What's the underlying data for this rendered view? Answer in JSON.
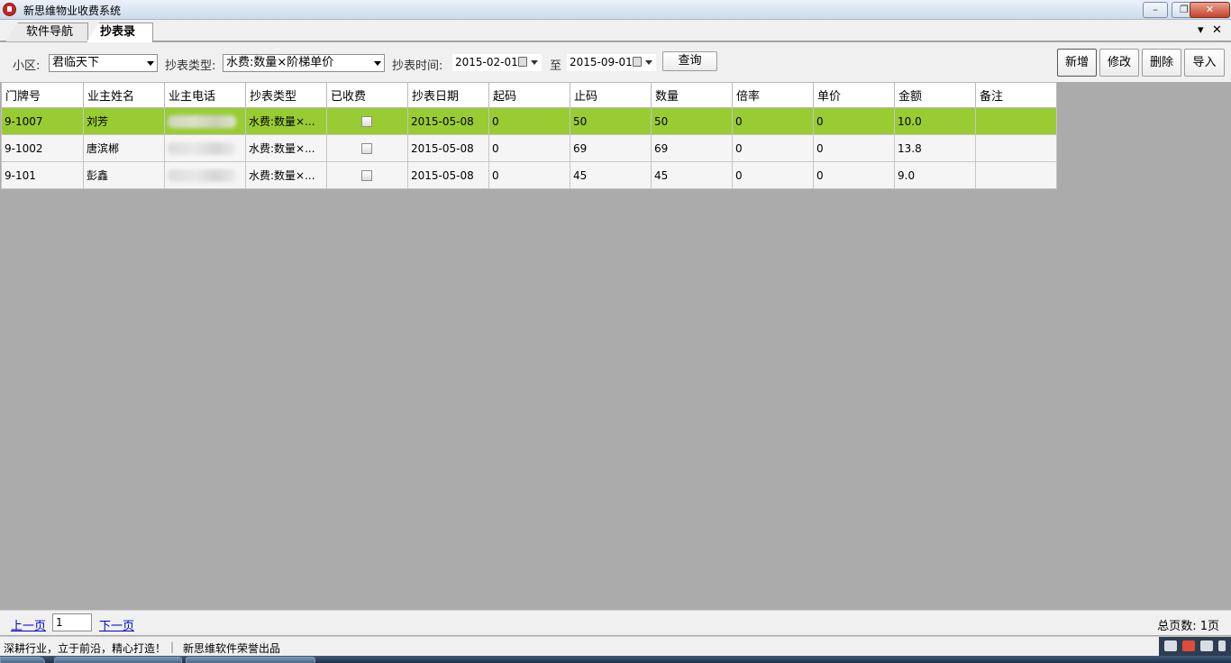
{
  "window": {
    "title": "新思维物业收费系统"
  },
  "tabs": [
    {
      "label": "软件导航页",
      "active": false
    },
    {
      "label": "抄表录入",
      "active": true
    }
  ],
  "toolbar": {
    "community_label": "小区:",
    "community_value": "君临天下",
    "type_label": "抄表类型:",
    "type_value": "水费:数量×阶梯单价",
    "time_label": "抄表时间:",
    "date_from": "2015-02-01",
    "to_label": "至",
    "date_to": "2015-09-01",
    "query_label": "查询",
    "add_label": "新增",
    "edit_label": "修改",
    "delete_label": "删除",
    "import_label": "导入"
  },
  "grid": {
    "columns": [
      "门牌号",
      "业主姓名",
      "业主电话",
      "抄表类型",
      "已收费",
      "抄表日期",
      "起码",
      "止码",
      "数量",
      "倍率",
      "单价",
      "金额",
      "备注"
    ],
    "rows": [
      {
        "room": "9-1007",
        "owner": "刘芳",
        "type": "水费:数量×...",
        "paid": false,
        "date": "2015-05-08",
        "start": "0",
        "end": "50",
        "qty": "50",
        "rate": "0",
        "price": "0",
        "amount": "10.0",
        "note": "",
        "selected": true
      },
      {
        "room": "9-1002",
        "owner": "唐滨郴",
        "type": "水费:数量×...",
        "paid": false,
        "date": "2015-05-08",
        "start": "0",
        "end": "69",
        "qty": "69",
        "rate": "0",
        "price": "0",
        "amount": "13.8",
        "note": "",
        "selected": false
      },
      {
        "room": "9-101",
        "owner": "彭鑫",
        "type": "水费:数量×...",
        "paid": false,
        "date": "2015-05-08",
        "start": "0",
        "end": "45",
        "qty": "45",
        "rate": "0",
        "price": "0",
        "amount": "9.0",
        "note": "",
        "selected": false
      }
    ]
  },
  "pager": {
    "prev_label": "上一页",
    "page_value": "1",
    "next_label": "下一页",
    "total_text": "总页数: 1页"
  },
  "status": {
    "slogan": "深耕行业，立于前沿，精心打造！",
    "company": "新思维软件荣誉出品"
  },
  "colors": {
    "selected_row": "#99cc33",
    "background": "#ababab",
    "link": "#0000cc"
  }
}
